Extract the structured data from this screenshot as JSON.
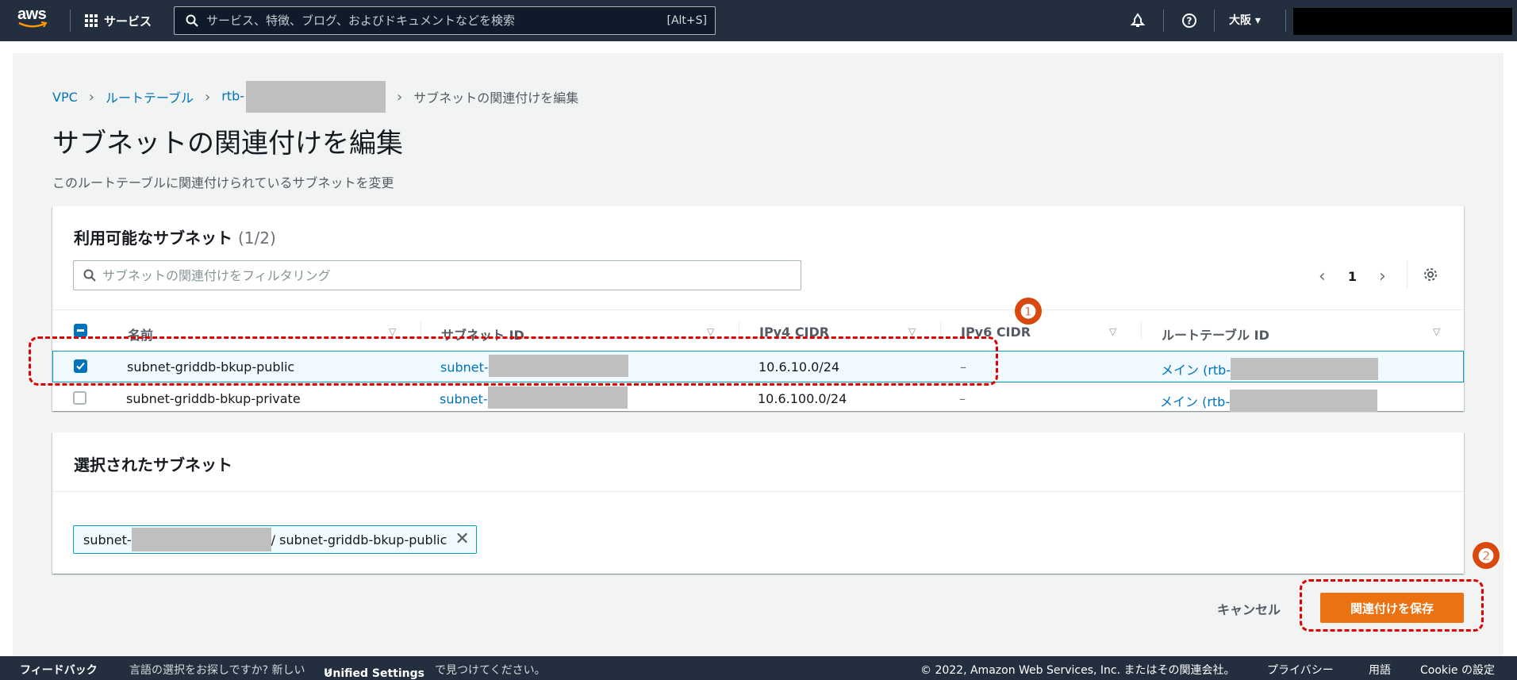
{
  "topnav": {
    "logo": "aws",
    "services_label": "サービス",
    "search_placeholder": "サービス、特徴、ブログ、およびドキュメントなどを検索",
    "search_shortcut": "[Alt+S]",
    "region": "大阪 ▾",
    "icons": [
      "bell-icon",
      "help-icon"
    ]
  },
  "breadcrumb": {
    "vpc": "VPC",
    "route_tables": "ルートテーブル",
    "rtb": "rtb-",
    "current": "サブネットの関連付けを編集"
  },
  "page": {
    "title": "サブネットの関連付けを編集",
    "description": "このルートテーブルに関連付けられているサブネットを変更"
  },
  "available": {
    "title": "利用可能なサブネット",
    "count": "(1/2)",
    "filter_placeholder": "サブネットの関連付けをフィルタリング",
    "page": "1",
    "columns": [
      "名前",
      "サブネット ID",
      "IPv4 CIDR",
      "IPv6 CIDR",
      "ルートテーブル ID"
    ],
    "rows": [
      {
        "name": "subnet-griddb-bkup-public",
        "subnet_id": "subnet-",
        "ipv4": "10.6.10.0/24",
        "ipv6": "–",
        "route_table": "メイン (rtb-",
        "checked": true
      },
      {
        "name": "subnet-griddb-bkup-private",
        "subnet_id": "subnet-",
        "ipv4": "10.6.100.0/24",
        "ipv6": "–",
        "route_table": "メイン (rtb-",
        "checked": false
      }
    ]
  },
  "selected": {
    "title": "選択されたサブネット",
    "token_prefix": "subnet-",
    "token_suffix": "/ subnet-griddb-bkup-public"
  },
  "actions": {
    "cancel": "キャンセル",
    "save": "関連付けを保存"
  },
  "annotations": {
    "badge1": "❶",
    "badge2": "❷",
    "color": "#e00000"
  },
  "footer": {
    "feedback": "フィードバック",
    "lang_pre": "言語の選択をお探しですか? 新しい",
    "unified": "Unified Settings",
    "lang_post": "で見つけてください。",
    "copyright": "© 2022, Amazon Web Services, Inc. またはその関連会社。",
    "privacy": "プライバシー",
    "terms": "用語",
    "cookie": "Cookie の設定"
  },
  "colors": {
    "nav_bg": "#232f3e",
    "link": "#0073bb",
    "primary_button": "#ec7211",
    "selected_row_border": "#00a1c9"
  }
}
